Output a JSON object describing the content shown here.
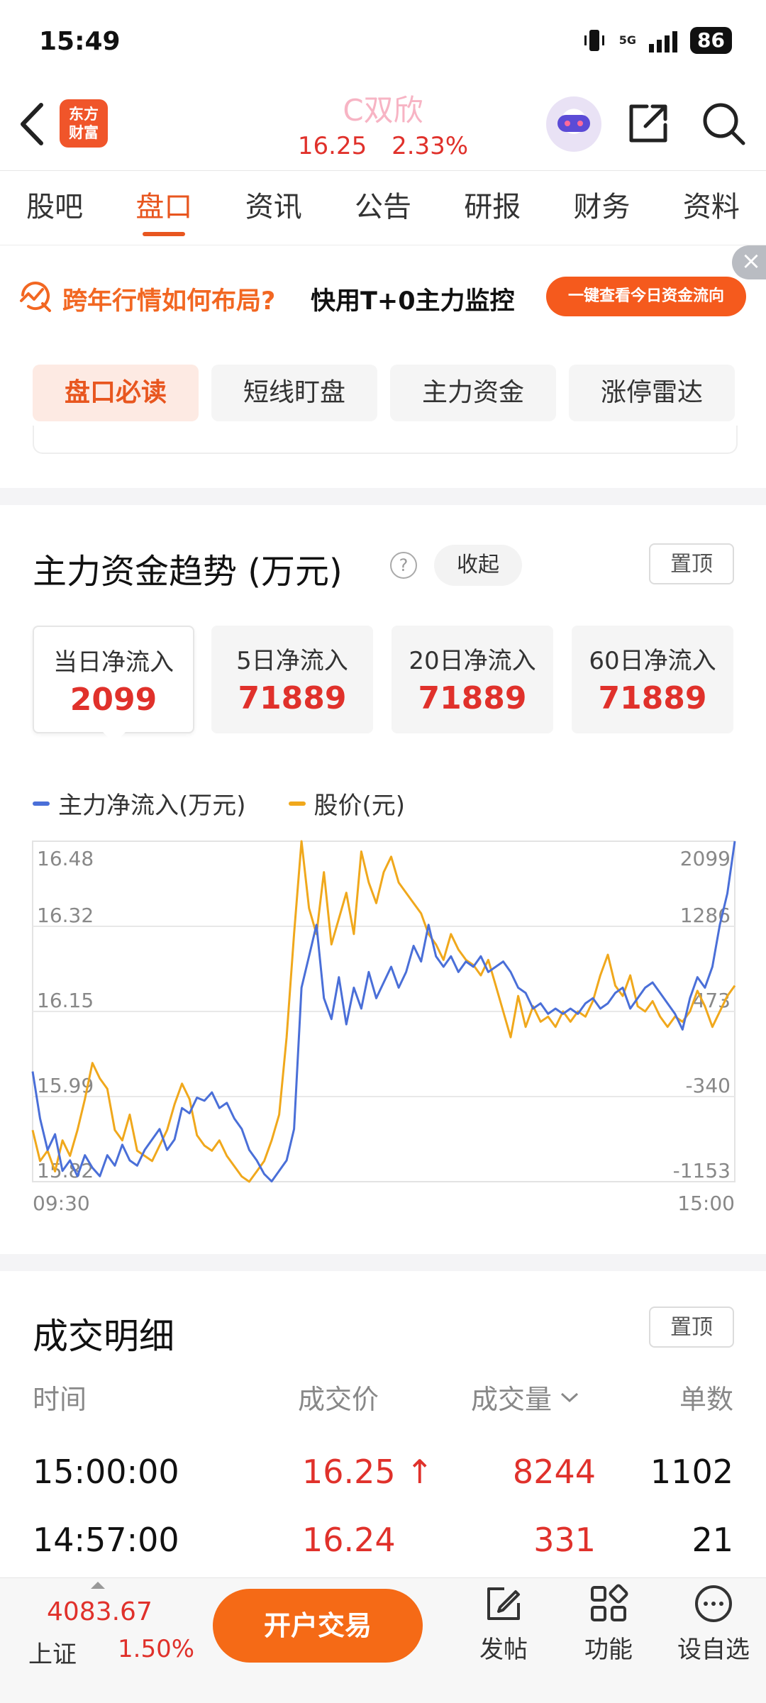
{
  "status_bar": {
    "time": "15:49",
    "network": "5G",
    "battery": "86"
  },
  "header": {
    "logo_line1": "东方",
    "logo_line2": "财富",
    "stock_name": "C双欣",
    "price": "16.25",
    "change_pct": "2.33%"
  },
  "tabs": [
    "股吧",
    "盘口",
    "资讯",
    "公告",
    "研报",
    "财务",
    "资料"
  ],
  "active_tab": "盘口",
  "promo": {
    "text1": "跨年行情如何布局?",
    "text2": "快用T+0主力监控",
    "button": "一键查看今日资金流向"
  },
  "sub_tabs": [
    "盘口必读",
    "短线盯盘",
    "主力资金",
    "涨停雷达"
  ],
  "fund_trend": {
    "title": "主力资金趋势 (万元)",
    "collapse_label": "收起",
    "pin_label": "置顶",
    "cards": [
      {
        "label": "当日净流入",
        "value": "2099"
      },
      {
        "label": "5日净流入",
        "value": "71889"
      },
      {
        "label": "20日净流入",
        "value": "71889"
      },
      {
        "label": "60日净流入",
        "value": "71889"
      }
    ],
    "legend": {
      "flow": "主力净流入(万元)",
      "price": "股价(元)"
    }
  },
  "chart_data": {
    "type": "line",
    "x_start": "09:30",
    "x_end": "15:00",
    "left_axis_ticks": [
      "16.48",
      "16.32",
      "16.15",
      "15.99",
      "15.82"
    ],
    "right_axis_ticks": [
      "2099",
      "1286",
      "473",
      "-340",
      "-1153"
    ],
    "left_range": [
      15.82,
      16.48
    ],
    "right_range": [
      -1153,
      2099
    ],
    "grid": true,
    "series": [
      {
        "name": "主力净流入(万元)",
        "color": "#4a6fd8",
        "axis": "right",
        "values": [
          -100,
          -550,
          -850,
          -700,
          -1050,
          -950,
          -1100,
          -900,
          -1020,
          -1100,
          -900,
          -1000,
          -800,
          -950,
          -1000,
          -850,
          -750,
          -650,
          -850,
          -750,
          -450,
          -500,
          -350,
          -380,
          -300,
          -450,
          -400,
          -550,
          -650,
          -850,
          -950,
          -1080,
          -1150,
          -1050,
          -950,
          -650,
          700,
          1000,
          1300,
          600,
          400,
          800,
          350,
          700,
          500,
          850,
          600,
          750,
          900,
          700,
          850,
          1100,
          950,
          1300,
          1000,
          900,
          1000,
          850,
          950,
          900,
          1000,
          850,
          900,
          950,
          850,
          700,
          650,
          500,
          550,
          450,
          500,
          450,
          500,
          450,
          550,
          600,
          500,
          550,
          650,
          700,
          500,
          600,
          700,
          750,
          650,
          550,
          450,
          300,
          600,
          800,
          700,
          900,
          1300,
          1600,
          2099
        ]
      },
      {
        "name": "股价(元)",
        "color": "#f0a81c",
        "axis": "left",
        "values": [
          15.92,
          15.86,
          15.88,
          15.84,
          15.9,
          15.87,
          15.92,
          15.98,
          16.05,
          16.02,
          16.0,
          15.92,
          15.9,
          15.95,
          15.88,
          15.87,
          15.86,
          15.89,
          15.92,
          15.97,
          16.01,
          15.98,
          15.91,
          15.89,
          15.88,
          15.9,
          15.87,
          15.85,
          15.83,
          15.82,
          15.84,
          15.86,
          15.9,
          15.95,
          16.1,
          16.3,
          16.48,
          16.35,
          16.3,
          16.42,
          16.28,
          16.33,
          16.38,
          16.3,
          16.46,
          16.4,
          16.36,
          16.42,
          16.45,
          16.4,
          16.38,
          16.36,
          16.34,
          16.3,
          16.28,
          16.25,
          16.3,
          16.27,
          16.25,
          16.24,
          16.22,
          16.25,
          16.2,
          16.15,
          16.1,
          16.18,
          16.12,
          16.16,
          16.13,
          16.14,
          16.12,
          16.15,
          16.13,
          16.15,
          16.14,
          16.17,
          16.22,
          16.26,
          16.2,
          16.18,
          16.22,
          16.16,
          16.15,
          16.17,
          16.14,
          16.12,
          16.14,
          16.13,
          16.15,
          16.19,
          16.16,
          16.12,
          16.15,
          16.18,
          16.2
        ]
      }
    ]
  },
  "trades": {
    "title": "成交明细",
    "pin_label": "置顶",
    "headers": {
      "time": "时间",
      "price": "成交价",
      "volume": "成交量",
      "count": "单数"
    },
    "rows": [
      {
        "time": "15:00:00",
        "price": "16.25",
        "arrow": "↑",
        "volume": "8244",
        "count": "1102"
      },
      {
        "time": "14:57:00",
        "price": "16.24",
        "arrow": "",
        "volume": "331",
        "count": "21"
      }
    ]
  },
  "bottom_bar": {
    "index_value": "4083.67",
    "index_name": "上证",
    "index_change": "1.50%",
    "trade_button": "开户交易",
    "actions": [
      "发帖",
      "功能",
      "设自选"
    ]
  }
}
